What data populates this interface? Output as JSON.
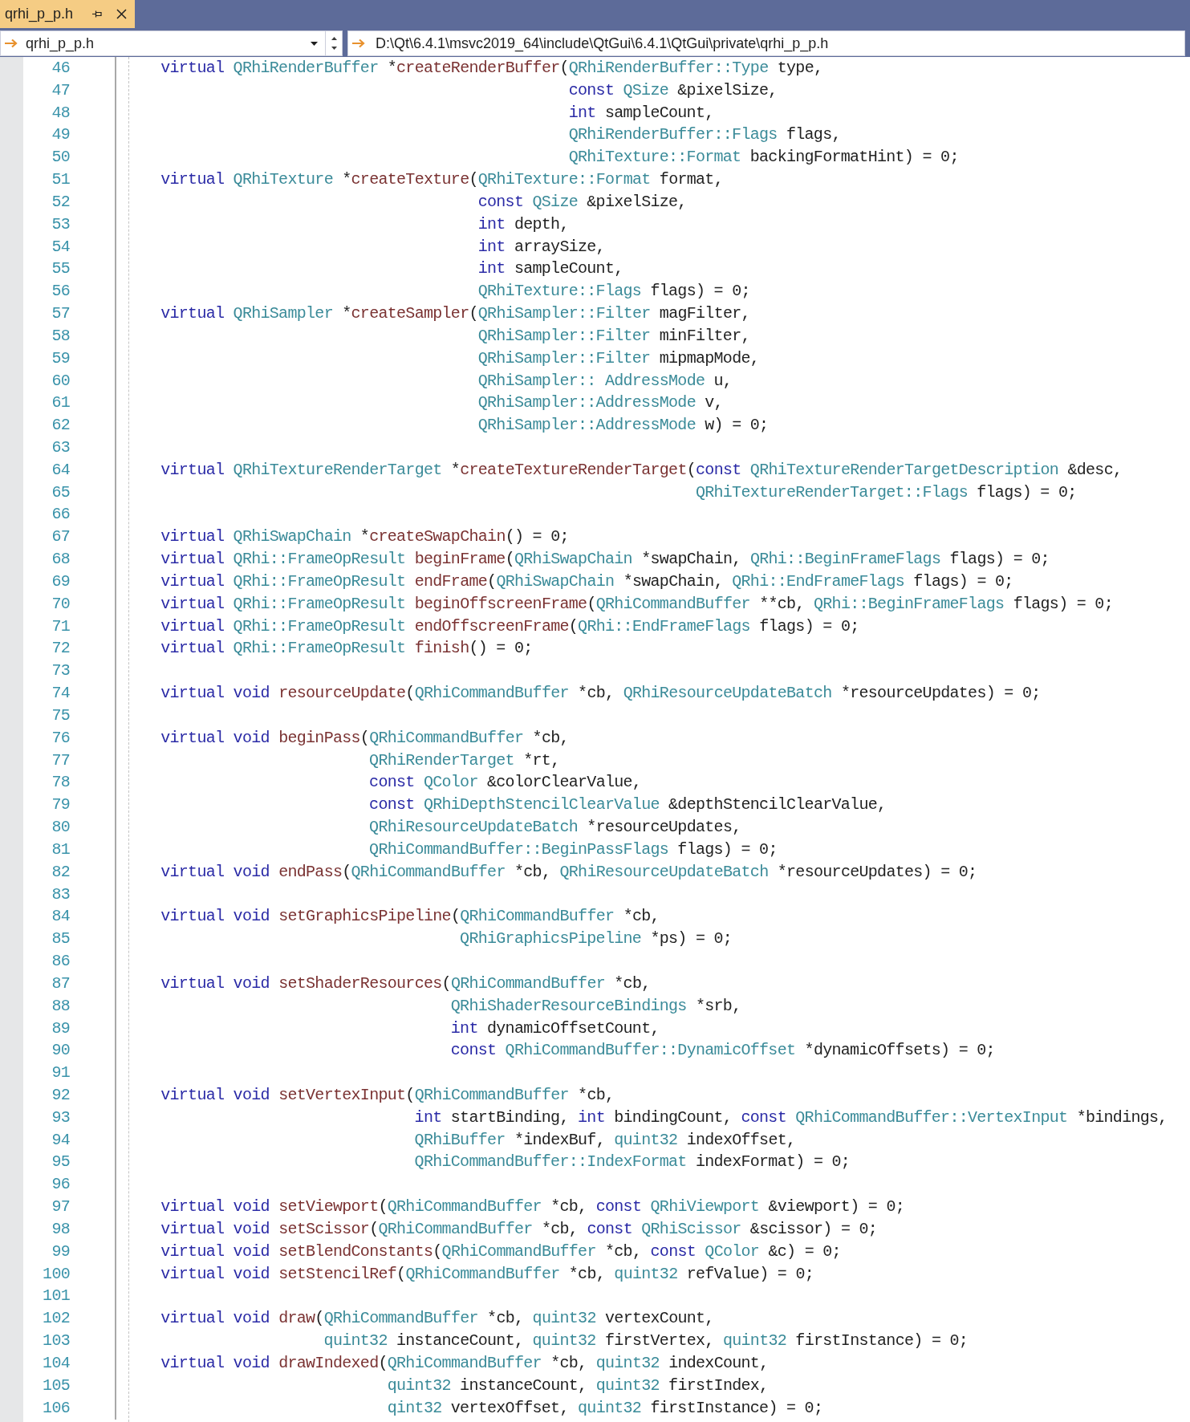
{
  "tabs": [
    {
      "label": "qrhi_p_p.h",
      "selected": true
    }
  ],
  "navigation_bar": {
    "file_dropdown": {
      "value": "qrhi_p_p.h"
    },
    "path_dropdown": {
      "value": "D:\\Qt\\6.4.1\\msvc2019_64\\include\\QtGui\\6.4.1\\QtGui\\private\\qrhi_p_p.h"
    }
  },
  "editor": {
    "lines": [
      {
        "number": "46",
        "kind": "statement",
        "tokens": [
          {
            "kind": "keyword",
            "text": "virtual "
          },
          {
            "kind": "type",
            "text": "QRhiRenderBuffer"
          },
          {
            "kind": "plain",
            "text": " *"
          },
          {
            "kind": "function",
            "text": "createRenderBuffer"
          },
          {
            "kind": "plain",
            "text": "("
          },
          {
            "kind": "type",
            "text": "QRhiRenderBuffer::Type"
          },
          {
            "kind": "plain",
            "text": " type,"
          }
        ]
      },
      {
        "number": "47",
        "kind": "continuation",
        "tokens": [
          {
            "kind": "keyword",
            "text": "const "
          },
          {
            "kind": "type",
            "text": "QSize"
          },
          {
            "kind": "plain",
            "text": " &pixelSize,"
          }
        ]
      },
      {
        "number": "48",
        "kind": "continuation",
        "tokens": [
          {
            "kind": "keyword",
            "text": "int"
          },
          {
            "kind": "plain",
            "text": " sampleCount,"
          }
        ]
      },
      {
        "number": "49",
        "kind": "continuation",
        "tokens": [
          {
            "kind": "type",
            "text": "QRhiRenderBuffer::Flags"
          },
          {
            "kind": "plain",
            "text": " flags,"
          }
        ]
      },
      {
        "number": "50",
        "kind": "continuation",
        "tokens": [
          {
            "kind": "type",
            "text": "QRhiTexture::Format"
          },
          {
            "kind": "plain",
            "text": " backingFormatHint) = 0;"
          }
        ]
      },
      {
        "number": "51",
        "kind": "statement",
        "tokens": [
          {
            "kind": "keyword",
            "text": "virtual "
          },
          {
            "kind": "type",
            "text": "QRhiTexture"
          },
          {
            "kind": "plain",
            "text": " *"
          },
          {
            "kind": "function",
            "text": "createTexture"
          },
          {
            "kind": "plain",
            "text": "("
          },
          {
            "kind": "type",
            "text": "QRhiTexture::Format"
          },
          {
            "kind": "plain",
            "text": " format,"
          }
        ]
      },
      {
        "number": "52",
        "kind": "continuation",
        "tokens": [
          {
            "kind": "keyword",
            "text": "const "
          },
          {
            "kind": "type",
            "text": "QSize"
          },
          {
            "kind": "plain",
            "text": " &pixelSize,"
          }
        ]
      },
      {
        "number": "53",
        "kind": "continuation",
        "tokens": [
          {
            "kind": "keyword",
            "text": "int"
          },
          {
            "kind": "plain",
            "text": " depth,"
          }
        ]
      },
      {
        "number": "54",
        "kind": "continuation",
        "tokens": [
          {
            "kind": "keyword",
            "text": "int"
          },
          {
            "kind": "plain",
            "text": " arraySize,"
          }
        ]
      },
      {
        "number": "55",
        "kind": "continuation",
        "tokens": [
          {
            "kind": "keyword",
            "text": "int"
          },
          {
            "kind": "plain",
            "text": " sampleCount,"
          }
        ]
      },
      {
        "number": "56",
        "kind": "continuation",
        "tokens": [
          {
            "kind": "type",
            "text": "QRhiTexture::Flags"
          },
          {
            "kind": "plain",
            "text": " flags) = 0;"
          }
        ]
      },
      {
        "number": "57",
        "kind": "statement",
        "tokens": [
          {
            "kind": "keyword",
            "text": "virtual "
          },
          {
            "kind": "type",
            "text": "QRhiSampler"
          },
          {
            "kind": "plain",
            "text": " *"
          },
          {
            "kind": "function",
            "text": "createSampler"
          },
          {
            "kind": "plain",
            "text": "("
          },
          {
            "kind": "type",
            "text": "QRhiSampler::Filter"
          },
          {
            "kind": "plain",
            "text": " magFilter,"
          }
        ]
      },
      {
        "number": "58",
        "kind": "continuation",
        "tokens": [
          {
            "kind": "type",
            "text": "QRhiSampler::Filter"
          },
          {
            "kind": "plain",
            "text": " minFilter,"
          }
        ]
      },
      {
        "number": "59",
        "kind": "continuation",
        "tokens": [
          {
            "kind": "type",
            "text": "QRhiSampler::Filter"
          },
          {
            "kind": "plain",
            "text": " mipmapMode,"
          }
        ]
      },
      {
        "number": "60",
        "kind": "continuation",
        "tokens": [
          {
            "kind": "type",
            "text": "QRhiSampler:: AddressMode"
          },
          {
            "kind": "plain",
            "text": " u,"
          }
        ]
      },
      {
        "number": "61",
        "kind": "continuation",
        "tokens": [
          {
            "kind": "type",
            "text": "QRhiSampler::AddressMode"
          },
          {
            "kind": "plain",
            "text": " v,"
          }
        ]
      },
      {
        "number": "62",
        "kind": "continuation",
        "tokens": [
          {
            "kind": "type",
            "text": "QRhiSampler::AddressMode"
          },
          {
            "kind": "plain",
            "text": " w) = 0;"
          }
        ]
      },
      {
        "number": "63",
        "kind": "blank"
      },
      {
        "number": "64",
        "kind": "statement",
        "tokens": [
          {
            "kind": "keyword",
            "text": "virtual "
          },
          {
            "kind": "type",
            "text": "QRhiTextureRenderTarget"
          },
          {
            "kind": "plain",
            "text": " *"
          },
          {
            "kind": "function",
            "text": "createTextureRenderTarget"
          },
          {
            "kind": "plain",
            "text": "("
          },
          {
            "kind": "keyword",
            "text": "const "
          },
          {
            "kind": "type",
            "text": "QRhiTextureRenderTargetDescription"
          },
          {
            "kind": "plain",
            "text": " &desc,"
          }
        ]
      },
      {
        "number": "65",
        "kind": "continuation",
        "tokens": [
          {
            "kind": "type",
            "text": "QRhiTextureRenderTarget::Flags"
          },
          {
            "kind": "plain",
            "text": " flags) = 0;"
          }
        ]
      },
      {
        "number": "66",
        "kind": "blank"
      },
      {
        "number": "67",
        "kind": "statement",
        "tokens": [
          {
            "kind": "keyword",
            "text": "virtual "
          },
          {
            "kind": "type",
            "text": "QRhiSwapChain"
          },
          {
            "kind": "plain",
            "text": " *"
          },
          {
            "kind": "function",
            "text": "createSwapChain"
          },
          {
            "kind": "plain",
            "text": "() = 0;"
          }
        ]
      },
      {
        "number": "68",
        "kind": "statement",
        "tokens": [
          {
            "kind": "keyword",
            "text": "virtual "
          },
          {
            "kind": "type",
            "text": "QRhi::FrameOpResult "
          },
          {
            "kind": "function",
            "text": "beginFrame"
          },
          {
            "kind": "plain",
            "text": "("
          },
          {
            "kind": "type",
            "text": "QRhiSwapChain"
          },
          {
            "kind": "plain",
            "text": " *swapChain, "
          },
          {
            "kind": "type",
            "text": "QRhi::BeginFrameFlags"
          },
          {
            "kind": "plain",
            "text": " flags) = 0;"
          }
        ]
      },
      {
        "number": "69",
        "kind": "statement",
        "tokens": [
          {
            "kind": "keyword",
            "text": "virtual "
          },
          {
            "kind": "type",
            "text": "QRhi::FrameOpResult "
          },
          {
            "kind": "function",
            "text": "endFrame"
          },
          {
            "kind": "plain",
            "text": "("
          },
          {
            "kind": "type",
            "text": "QRhiSwapChain"
          },
          {
            "kind": "plain",
            "text": " *swapChain, "
          },
          {
            "kind": "type",
            "text": "QRhi::EndFrameFlags"
          },
          {
            "kind": "plain",
            "text": " flags) = 0;"
          }
        ]
      },
      {
        "number": "70",
        "kind": "statement",
        "tokens": [
          {
            "kind": "keyword",
            "text": "virtual "
          },
          {
            "kind": "type",
            "text": "QRhi::FrameOpResult "
          },
          {
            "kind": "function",
            "text": "beginOffscreenFrame"
          },
          {
            "kind": "plain",
            "text": "("
          },
          {
            "kind": "type",
            "text": "QRhiCommandBuffer"
          },
          {
            "kind": "plain",
            "text": " **cb, "
          },
          {
            "kind": "type",
            "text": "QRhi::BeginFrameFlags"
          },
          {
            "kind": "plain",
            "text": " flags) = 0;"
          }
        ]
      },
      {
        "number": "71",
        "kind": "statement",
        "tokens": [
          {
            "kind": "keyword",
            "text": "virtual "
          },
          {
            "kind": "type",
            "text": "QRhi::FrameOpResult "
          },
          {
            "kind": "function",
            "text": "endOffscreenFrame"
          },
          {
            "kind": "plain",
            "text": "("
          },
          {
            "kind": "type",
            "text": "QRhi::EndFrameFlags"
          },
          {
            "kind": "plain",
            "text": " flags) = 0;"
          }
        ]
      },
      {
        "number": "72",
        "kind": "statement",
        "tokens": [
          {
            "kind": "keyword",
            "text": "virtual "
          },
          {
            "kind": "type",
            "text": "QRhi::FrameOpResult "
          },
          {
            "kind": "function",
            "text": "finish"
          },
          {
            "kind": "plain",
            "text": "() = 0;"
          }
        ]
      },
      {
        "number": "73",
        "kind": "blank"
      },
      {
        "number": "74",
        "kind": "statement",
        "tokens": [
          {
            "kind": "keyword",
            "text": "virtual void "
          },
          {
            "kind": "function",
            "text": "resourceUpdate"
          },
          {
            "kind": "plain",
            "text": "("
          },
          {
            "kind": "type",
            "text": "QRhiCommandBuffer"
          },
          {
            "kind": "plain",
            "text": " *cb, "
          },
          {
            "kind": "type",
            "text": "QRhiResourceUpdateBatch"
          },
          {
            "kind": "plain",
            "text": " *resourceUpdates) = 0;"
          }
        ]
      },
      {
        "number": "75",
        "kind": "blank"
      },
      {
        "number": "76",
        "kind": "statement",
        "tokens": [
          {
            "kind": "keyword",
            "text": "virtual void "
          },
          {
            "kind": "function",
            "text": "beginPass"
          },
          {
            "kind": "plain",
            "text": "("
          },
          {
            "kind": "type",
            "text": "QRhiCommandBuffer"
          },
          {
            "kind": "plain",
            "text": " *cb,"
          }
        ]
      },
      {
        "number": "77",
        "kind": "continuation",
        "tokens": [
          {
            "kind": "type",
            "text": "QRhiRenderTarget"
          },
          {
            "kind": "plain",
            "text": " *rt,"
          }
        ]
      },
      {
        "number": "78",
        "kind": "continuation",
        "tokens": [
          {
            "kind": "keyword",
            "text": "const "
          },
          {
            "kind": "type",
            "text": "QColor"
          },
          {
            "kind": "plain",
            "text": " &colorClearValue,"
          }
        ]
      },
      {
        "number": "79",
        "kind": "continuation",
        "tokens": [
          {
            "kind": "keyword",
            "text": "const "
          },
          {
            "kind": "type",
            "text": "QRhiDepthStencilClearValue"
          },
          {
            "kind": "plain",
            "text": " &depthStencilClearValue,"
          }
        ]
      },
      {
        "number": "80",
        "kind": "continuation",
        "tokens": [
          {
            "kind": "type",
            "text": "QRhiResourceUpdateBatch"
          },
          {
            "kind": "plain",
            "text": " *resourceUpdates,"
          }
        ]
      },
      {
        "number": "81",
        "kind": "continuation",
        "tokens": [
          {
            "kind": "type",
            "text": "QRhiCommandBuffer::BeginPassFlags"
          },
          {
            "kind": "plain",
            "text": " flags) = 0;"
          }
        ]
      },
      {
        "number": "82",
        "kind": "statement",
        "tokens": [
          {
            "kind": "keyword",
            "text": "virtual void "
          },
          {
            "kind": "function",
            "text": "endPass"
          },
          {
            "kind": "plain",
            "text": "("
          },
          {
            "kind": "type",
            "text": "QRhiCommandBuffer"
          },
          {
            "kind": "plain",
            "text": " *cb, "
          },
          {
            "kind": "type",
            "text": "QRhiResourceUpdateBatch"
          },
          {
            "kind": "plain",
            "text": " *resourceUpdates) = 0;"
          }
        ]
      },
      {
        "number": "83",
        "kind": "blank"
      },
      {
        "number": "84",
        "kind": "statement",
        "tokens": [
          {
            "kind": "keyword",
            "text": "virtual void "
          },
          {
            "kind": "function",
            "text": "setGraphicsPipeline"
          },
          {
            "kind": "plain",
            "text": "("
          },
          {
            "kind": "type",
            "text": "QRhiCommandBuffer"
          },
          {
            "kind": "plain",
            "text": " *cb,"
          }
        ]
      },
      {
        "number": "85",
        "kind": "continuation",
        "tokens": [
          {
            "kind": "type",
            "text": "QRhiGraphicsPipeline"
          },
          {
            "kind": "plain",
            "text": " *ps) = 0;"
          }
        ]
      },
      {
        "number": "86",
        "kind": "blank"
      },
      {
        "number": "87",
        "kind": "statement",
        "tokens": [
          {
            "kind": "keyword",
            "text": "virtual void "
          },
          {
            "kind": "function",
            "text": "setShaderResources"
          },
          {
            "kind": "plain",
            "text": "("
          },
          {
            "kind": "type",
            "text": "QRhiCommandBuffer"
          },
          {
            "kind": "plain",
            "text": " *cb,"
          }
        ]
      },
      {
        "number": "88",
        "kind": "continuation",
        "tokens": [
          {
            "kind": "type",
            "text": "QRhiShaderResourceBindings"
          },
          {
            "kind": "plain",
            "text": " *srb,"
          }
        ]
      },
      {
        "number": "89",
        "kind": "continuation",
        "tokens": [
          {
            "kind": "keyword",
            "text": "int"
          },
          {
            "kind": "plain",
            "text": " dynamicOffsetCount,"
          }
        ]
      },
      {
        "number": "90",
        "kind": "continuation",
        "tokens": [
          {
            "kind": "keyword",
            "text": "const "
          },
          {
            "kind": "type",
            "text": "QRhiCommandBuffer::DynamicOffset"
          },
          {
            "kind": "plain",
            "text": " *dynamicOffsets) = 0;"
          }
        ]
      },
      {
        "number": "91",
        "kind": "blank"
      },
      {
        "number": "92",
        "kind": "statement",
        "tokens": [
          {
            "kind": "keyword",
            "text": "virtual void "
          },
          {
            "kind": "function",
            "text": "setVertexInput"
          },
          {
            "kind": "plain",
            "text": "("
          },
          {
            "kind": "type",
            "text": "QRhiCommandBuffer"
          },
          {
            "kind": "plain",
            "text": " *cb,"
          }
        ]
      },
      {
        "number": "93",
        "kind": "continuation",
        "tokens": [
          {
            "kind": "keyword",
            "text": "int"
          },
          {
            "kind": "plain",
            "text": " startBinding, "
          },
          {
            "kind": "keyword",
            "text": "int"
          },
          {
            "kind": "plain",
            "text": " bindingCount, "
          },
          {
            "kind": "keyword",
            "text": "const "
          },
          {
            "kind": "type",
            "text": "QRhiCommandBuffer::VertexInput"
          },
          {
            "kind": "plain",
            "text": " *bindings,"
          }
        ]
      },
      {
        "number": "94",
        "kind": "continuation",
        "tokens": [
          {
            "kind": "type",
            "text": "QRhiBuffer"
          },
          {
            "kind": "plain",
            "text": " *indexBuf, "
          },
          {
            "kind": "type",
            "text": "quint32"
          },
          {
            "kind": "plain",
            "text": " indexOffset,"
          }
        ]
      },
      {
        "number": "95",
        "kind": "continuation",
        "tokens": [
          {
            "kind": "type",
            "text": "QRhiCommandBuffer::IndexFormat"
          },
          {
            "kind": "plain",
            "text": " indexFormat) = 0;"
          }
        ]
      },
      {
        "number": "96",
        "kind": "blank"
      },
      {
        "number": "97",
        "kind": "statement",
        "tokens": [
          {
            "kind": "keyword",
            "text": "virtual void "
          },
          {
            "kind": "function",
            "text": "setViewport"
          },
          {
            "kind": "plain",
            "text": "("
          },
          {
            "kind": "type",
            "text": "QRhiCommandBuffer"
          },
          {
            "kind": "plain",
            "text": " *cb, "
          },
          {
            "kind": "keyword",
            "text": "const "
          },
          {
            "kind": "type",
            "text": "QRhiViewport"
          },
          {
            "kind": "plain",
            "text": " &viewport) = 0;"
          }
        ]
      },
      {
        "number": "98",
        "kind": "statement",
        "tokens": [
          {
            "kind": "keyword",
            "text": "virtual void "
          },
          {
            "kind": "function",
            "text": "setScissor"
          },
          {
            "kind": "plain",
            "text": "("
          },
          {
            "kind": "type",
            "text": "QRhiCommandBuffer"
          },
          {
            "kind": "plain",
            "text": " *cb, "
          },
          {
            "kind": "keyword",
            "text": "const "
          },
          {
            "kind": "type",
            "text": "QRhiScissor"
          },
          {
            "kind": "plain",
            "text": " &scissor) = 0;"
          }
        ]
      },
      {
        "number": "99",
        "kind": "statement",
        "tokens": [
          {
            "kind": "keyword",
            "text": "virtual void "
          },
          {
            "kind": "function",
            "text": "setBlendConstants"
          },
          {
            "kind": "plain",
            "text": "("
          },
          {
            "kind": "type",
            "text": "QRhiCommandBuffer"
          },
          {
            "kind": "plain",
            "text": " *cb, "
          },
          {
            "kind": "keyword",
            "text": "const "
          },
          {
            "kind": "type",
            "text": "QColor"
          },
          {
            "kind": "plain",
            "text": " &c) = 0;"
          }
        ]
      },
      {
        "number": "100",
        "kind": "statement",
        "tokens": [
          {
            "kind": "keyword",
            "text": "virtual void "
          },
          {
            "kind": "function",
            "text": "setStencilRef"
          },
          {
            "kind": "plain",
            "text": "("
          },
          {
            "kind": "type",
            "text": "QRhiCommandBuffer"
          },
          {
            "kind": "plain",
            "text": " *cb, "
          },
          {
            "kind": "type",
            "text": "quint32"
          },
          {
            "kind": "plain",
            "text": " refValue) = 0;"
          }
        ]
      },
      {
        "number": "101",
        "kind": "blank"
      },
      {
        "number": "102",
        "kind": "statement",
        "tokens": [
          {
            "kind": "keyword",
            "text": "virtual void "
          },
          {
            "kind": "function",
            "text": "draw"
          },
          {
            "kind": "plain",
            "text": "("
          },
          {
            "kind": "type",
            "text": "QRhiCommandBuffer"
          },
          {
            "kind": "plain",
            "text": " *cb, "
          },
          {
            "kind": "type",
            "text": "quint32"
          },
          {
            "kind": "plain",
            "text": " vertexCount,"
          }
        ]
      },
      {
        "number": "103",
        "kind": "continuation",
        "tokens": [
          {
            "kind": "type",
            "text": "quint32"
          },
          {
            "kind": "plain",
            "text": " instanceCount, "
          },
          {
            "kind": "type",
            "text": "quint32"
          },
          {
            "kind": "plain",
            "text": " firstVertex, "
          },
          {
            "kind": "type",
            "text": "quint32"
          },
          {
            "kind": "plain",
            "text": " firstInstance) = 0;"
          }
        ]
      },
      {
        "number": "104",
        "kind": "statement",
        "tokens": [
          {
            "kind": "keyword",
            "text": "virtual void "
          },
          {
            "kind": "function",
            "text": "drawIndexed"
          },
          {
            "kind": "plain",
            "text": "("
          },
          {
            "kind": "type",
            "text": "QRhiCommandBuffer"
          },
          {
            "kind": "plain",
            "text": " *cb, "
          },
          {
            "kind": "type",
            "text": "quint32"
          },
          {
            "kind": "plain",
            "text": " indexCount,"
          }
        ]
      },
      {
        "number": "105",
        "kind": "continuation",
        "tokens": [
          {
            "kind": "type",
            "text": "quint32"
          },
          {
            "kind": "plain",
            "text": " instanceCount, "
          },
          {
            "kind": "type",
            "text": "quint32"
          },
          {
            "kind": "plain",
            "text": " firstIndex,"
          }
        ]
      },
      {
        "number": "106",
        "kind": "continuation",
        "tokens": [
          {
            "kind": "type",
            "text": "qint32"
          },
          {
            "kind": "plain",
            "text": " vertexOffset, "
          },
          {
            "kind": "type",
            "text": "quint32"
          },
          {
            "kind": "plain",
            "text": " firstInstance) = 0;"
          }
        ]
      }
    ]
  }
}
